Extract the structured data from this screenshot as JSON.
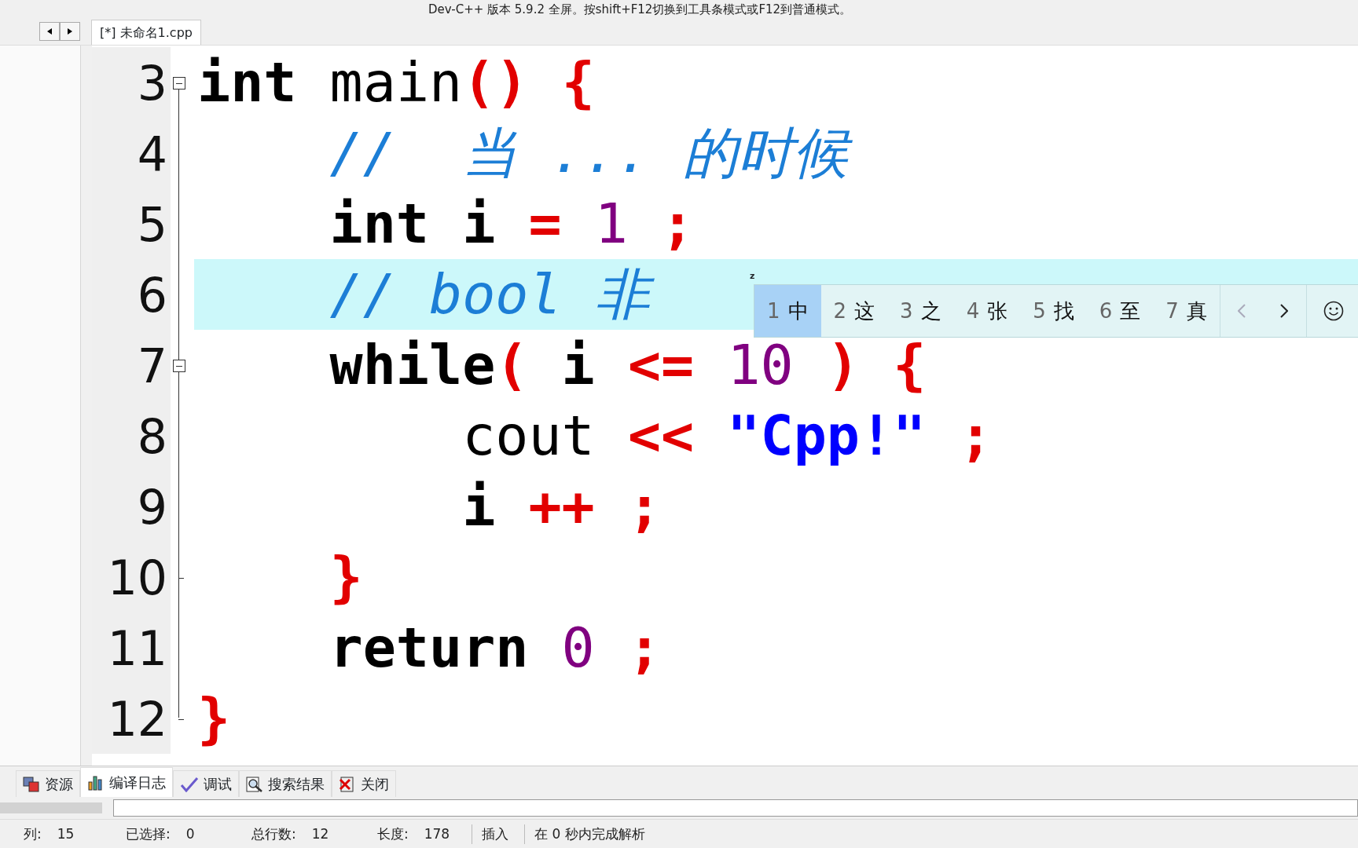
{
  "window": {
    "title": "Dev-C++ 版本 5.9.2 全屏。按shift+F12切换到工具条模式或F12到普通模式。"
  },
  "file_tabs": [
    {
      "label": "[*] 未命名1.cpp",
      "selected": true
    }
  ],
  "editor": {
    "lines": [
      {
        "number": "3",
        "expanded": true,
        "highlighted": false,
        "tokens": [
          {
            "text": "int",
            "kind": "keyword"
          },
          {
            "text": "main",
            "kind": "ident"
          },
          {
            "text": "()",
            "kind": "op",
            "attached": true
          },
          {
            "text": "{",
            "kind": "op"
          }
        ],
        "children": [
          {
            "number": "4",
            "highlighted": false,
            "tokens": [
              {
                "text": "//  当 ... 的时候",
                "kind": "comment"
              }
            ]
          },
          {
            "number": "5",
            "highlighted": false,
            "tokens": [
              {
                "text": "int",
                "kind": "keyword"
              },
              {
                "text": "i",
                "kind": "keyword"
              },
              {
                "text": "=",
                "kind": "op"
              },
              {
                "text": "1",
                "kind": "num"
              },
              {
                "text": ";",
                "kind": "op"
              }
            ]
          },
          {
            "number": "6",
            "highlighted": true,
            "tokens": [
              {
                "text": "// bool 非",
                "kind": "comment"
              }
            ]
          },
          {
            "number": "7",
            "expanded": true,
            "highlighted": false,
            "tokens": [
              {
                "text": "while",
                "kind": "keyword"
              },
              {
                "text": "(",
                "kind": "op",
                "attached": true
              },
              {
                "text": "i",
                "kind": "keyword"
              },
              {
                "text": "<=",
                "kind": "op"
              },
              {
                "text": "10",
                "kind": "num"
              },
              {
                "text": ")",
                "kind": "op"
              },
              {
                "text": "{",
                "kind": "op"
              }
            ],
            "children": [
              {
                "number": "8",
                "highlighted": false,
                "tokens": [
                  {
                    "text": "cout",
                    "kind": "ident"
                  },
                  {
                    "text": "<<",
                    "kind": "op"
                  },
                  {
                    "text": "\"Cpp!\"",
                    "kind": "str"
                  },
                  {
                    "text": ";",
                    "kind": "op"
                  }
                ]
              },
              {
                "number": "9",
                "highlighted": false,
                "tokens": [
                  {
                    "text": "i",
                    "kind": "keyword"
                  },
                  {
                    "text": "++",
                    "kind": "op"
                  },
                  {
                    "text": ";",
                    "kind": "op"
                  }
                ]
              }
            ]
          },
          {
            "number": "10",
            "highlighted": false,
            "close": true,
            "tokens": [
              {
                "text": "}",
                "kind": "op"
              }
            ]
          },
          {
            "number": "11",
            "highlighted": false,
            "tokens": [
              {
                "text": "return",
                "kind": "keyword"
              },
              {
                "text": "0",
                "kind": "num"
              },
              {
                "text": ";",
                "kind": "op"
              }
            ]
          }
        ]
      },
      {
        "number": "12",
        "highlighted": false,
        "close": true,
        "tokens": [
          {
            "text": "}",
            "kind": "op"
          }
        ]
      }
    ]
  },
  "ime": {
    "marker": "z",
    "candidates": [
      {
        "index": "1",
        "text": "中",
        "selected": true
      },
      {
        "index": "2",
        "text": "这",
        "selected": false
      },
      {
        "index": "3",
        "text": "之",
        "selected": false
      },
      {
        "index": "4",
        "text": "张",
        "selected": false
      },
      {
        "index": "5",
        "text": "找",
        "selected": false
      },
      {
        "index": "6",
        "text": "至",
        "selected": false
      },
      {
        "index": "7",
        "text": "真",
        "selected": false
      }
    ],
    "prev_disabled": true,
    "next_disabled": false
  },
  "bottom_tabs": [
    {
      "label": "资源",
      "kind": "resources",
      "selected": false
    },
    {
      "label": "编译日志",
      "kind": "log",
      "selected": true
    },
    {
      "label": "调试",
      "kind": "debug",
      "selected": false
    },
    {
      "label": "搜索结果",
      "kind": "search",
      "selected": false
    },
    {
      "label": "关闭",
      "kind": "close",
      "selected": false
    }
  ],
  "status_bar": [
    {
      "label": "列:",
      "value": "15"
    },
    {
      "label": "已选择:",
      "value": "0"
    },
    {
      "label": "总行数:",
      "value": "12"
    },
    {
      "label": "长度:",
      "value": "178"
    },
    {
      "value": "插入"
    },
    {
      "value": "在 0 秒内完成解析"
    }
  ]
}
